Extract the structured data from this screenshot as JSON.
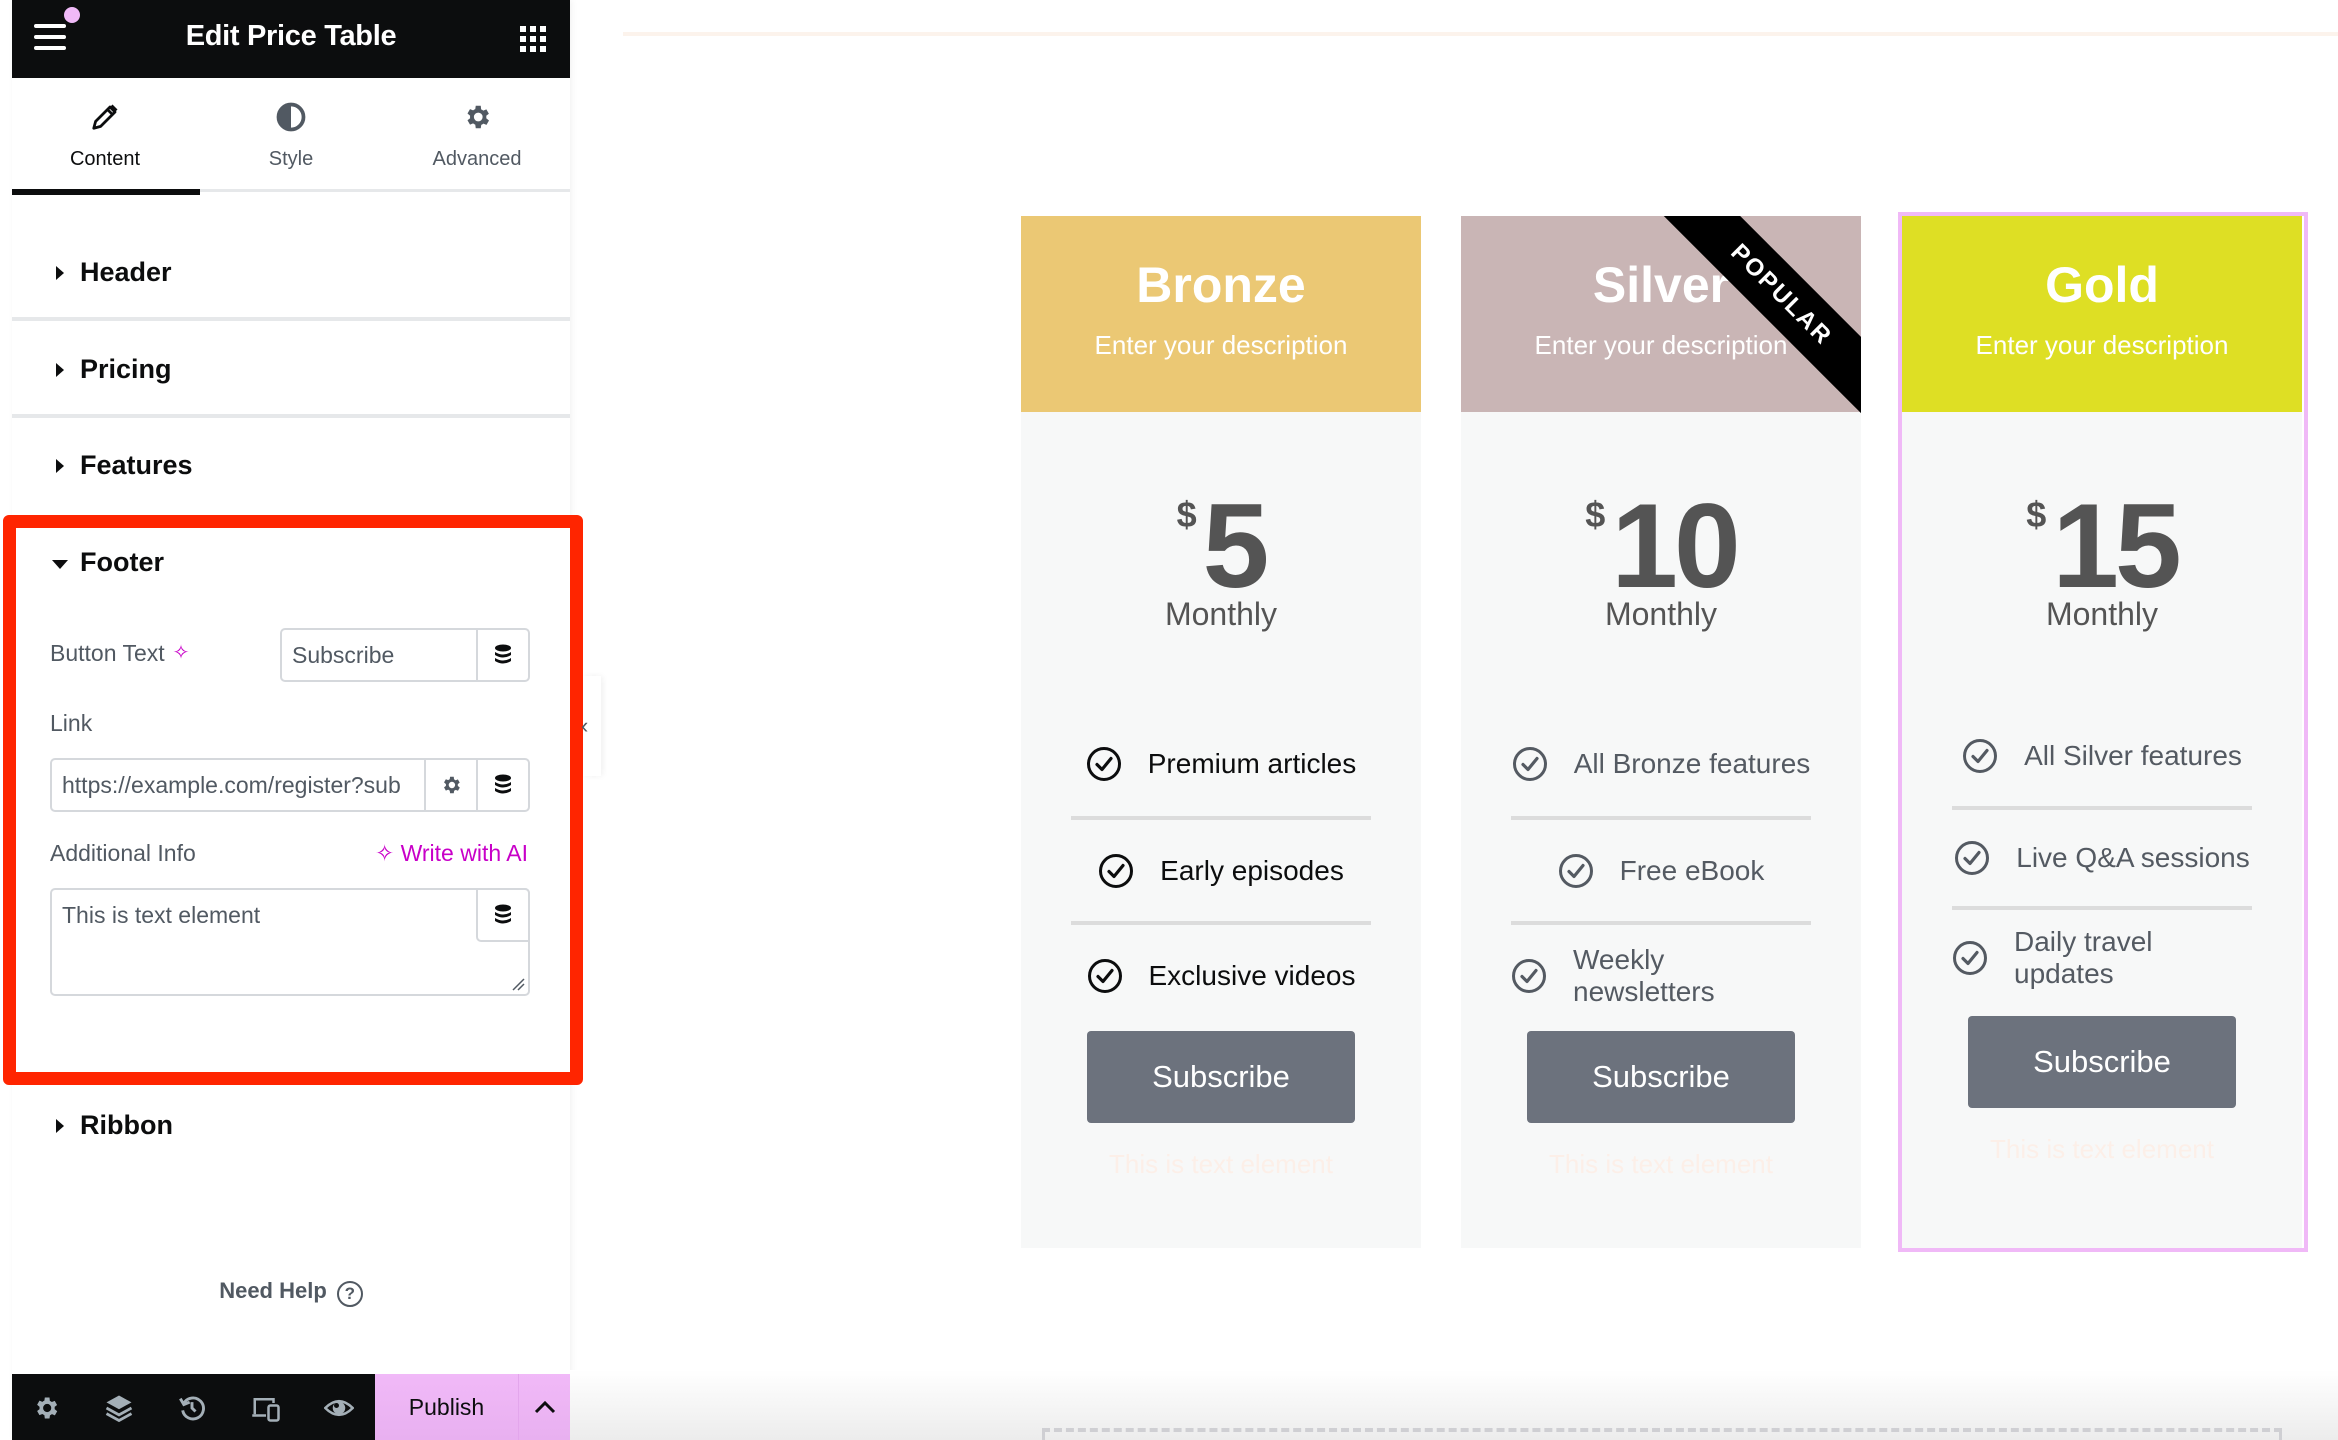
{
  "panel": {
    "title": "Edit Price Table",
    "tabs": [
      {
        "label": "Content",
        "icon": "pencil-icon",
        "active": true
      },
      {
        "label": "Style",
        "icon": "half-circle-icon",
        "active": false
      },
      {
        "label": "Advanced",
        "icon": "gear-icon",
        "active": false
      }
    ],
    "sections": {
      "header": "Header",
      "pricing": "Pricing",
      "features": "Features",
      "footer": "Footer",
      "ribbon": "Ribbon"
    },
    "footer": {
      "button_text_label": "Button Text",
      "button_text_value": "Subscribe",
      "link_label": "Link",
      "link_value": "https://example.com/register?sub",
      "additional_info_label": "Additional Info",
      "write_with_ai": "Write with AI",
      "additional_info_value": "This is text element"
    },
    "need_help": "Need Help",
    "bottom_bar": {
      "icons": [
        "settings-icon",
        "layers-icon",
        "history-icon",
        "responsive-icon",
        "preview-eye-icon"
      ],
      "publish_label": "Publish"
    }
  },
  "colors": {
    "bronze": "#ebc874",
    "silver": "#c9b5b5",
    "gold": "#dedf24",
    "button": "#6c727d",
    "selection": "#f0b9f7",
    "highlight": "#ff2500",
    "ai": "#c800c8"
  },
  "cards": [
    {
      "title": "Bronze",
      "description": "Enter your description",
      "currency": "$",
      "price": "5",
      "period": "Monthly",
      "features": [
        "Premium articles",
        "Early episodes",
        "Exclusive videos"
      ],
      "button": "Subscribe",
      "additional_info": "This is text element"
    },
    {
      "title": "Silver",
      "description": "Enter your description",
      "currency": "$",
      "price": "10",
      "period": "Monthly",
      "ribbon": "POPULAR",
      "features": [
        "All Bronze features",
        "Free eBook",
        "Weekly newsletters"
      ],
      "button": "Subscribe",
      "additional_info": "This is text element"
    },
    {
      "title": "Gold",
      "description": "Enter your description",
      "currency": "$",
      "price": "15",
      "period": "Monthly",
      "features": [
        "All Silver features",
        "Live Q&A sessions",
        "Daily travel updates"
      ],
      "button": "Subscribe",
      "additional_info": "This is text element"
    }
  ]
}
